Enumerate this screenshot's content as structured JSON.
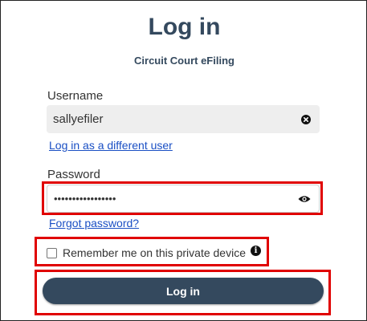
{
  "header": {
    "title": "Log in",
    "subtitle": "Circuit Court eFiling"
  },
  "username": {
    "label": "Username",
    "value": "sallyefiler",
    "clear_icon": "clear-x-circle-icon",
    "switch_user_link": "Log in as a different user"
  },
  "password": {
    "label": "Password",
    "value": "•••••••••••••••••",
    "reveal_icon": "eye-icon",
    "forgot_link": "Forgot password?"
  },
  "remember": {
    "label": "Remember me on this private device",
    "checked": false,
    "info_icon": "info-icon",
    "info_glyph": "i"
  },
  "submit": {
    "label": "Log in"
  },
  "colors": {
    "brand": "#34495e",
    "link": "#1a4fc4",
    "highlight": "#e00000",
    "readonly_field": "#eeeeee"
  }
}
